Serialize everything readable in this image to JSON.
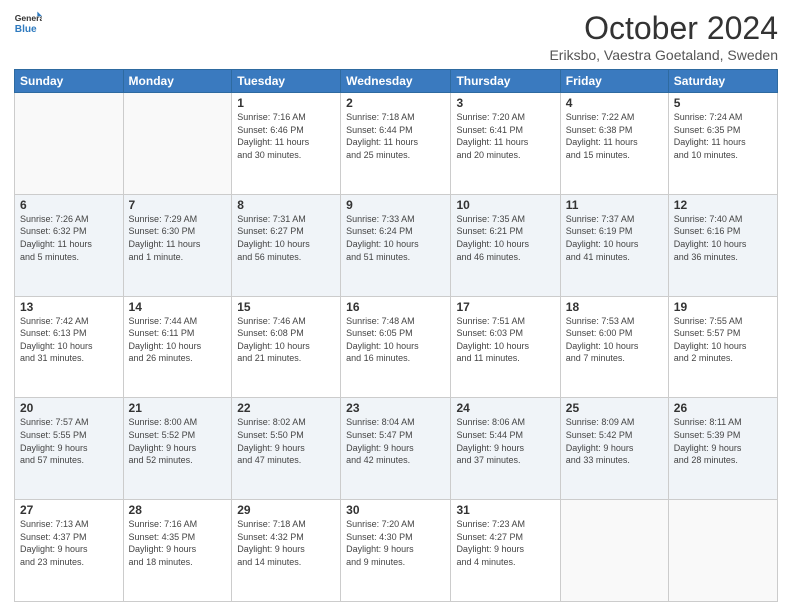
{
  "header": {
    "logo_line1": "General",
    "logo_line2": "Blue",
    "month": "October 2024",
    "location": "Eriksbo, Vaestra Goetaland, Sweden"
  },
  "days_of_week": [
    "Sunday",
    "Monday",
    "Tuesday",
    "Wednesday",
    "Thursday",
    "Friday",
    "Saturday"
  ],
  "weeks": [
    [
      {
        "day": "",
        "info": ""
      },
      {
        "day": "",
        "info": ""
      },
      {
        "day": "1",
        "info": "Sunrise: 7:16 AM\nSunset: 6:46 PM\nDaylight: 11 hours\nand 30 minutes."
      },
      {
        "day": "2",
        "info": "Sunrise: 7:18 AM\nSunset: 6:44 PM\nDaylight: 11 hours\nand 25 minutes."
      },
      {
        "day": "3",
        "info": "Sunrise: 7:20 AM\nSunset: 6:41 PM\nDaylight: 11 hours\nand 20 minutes."
      },
      {
        "day": "4",
        "info": "Sunrise: 7:22 AM\nSunset: 6:38 PM\nDaylight: 11 hours\nand 15 minutes."
      },
      {
        "day": "5",
        "info": "Sunrise: 7:24 AM\nSunset: 6:35 PM\nDaylight: 11 hours\nand 10 minutes."
      }
    ],
    [
      {
        "day": "6",
        "info": "Sunrise: 7:26 AM\nSunset: 6:32 PM\nDaylight: 11 hours\nand 5 minutes."
      },
      {
        "day": "7",
        "info": "Sunrise: 7:29 AM\nSunset: 6:30 PM\nDaylight: 11 hours\nand 1 minute."
      },
      {
        "day": "8",
        "info": "Sunrise: 7:31 AM\nSunset: 6:27 PM\nDaylight: 10 hours\nand 56 minutes."
      },
      {
        "day": "9",
        "info": "Sunrise: 7:33 AM\nSunset: 6:24 PM\nDaylight: 10 hours\nand 51 minutes."
      },
      {
        "day": "10",
        "info": "Sunrise: 7:35 AM\nSunset: 6:21 PM\nDaylight: 10 hours\nand 46 minutes."
      },
      {
        "day": "11",
        "info": "Sunrise: 7:37 AM\nSunset: 6:19 PM\nDaylight: 10 hours\nand 41 minutes."
      },
      {
        "day": "12",
        "info": "Sunrise: 7:40 AM\nSunset: 6:16 PM\nDaylight: 10 hours\nand 36 minutes."
      }
    ],
    [
      {
        "day": "13",
        "info": "Sunrise: 7:42 AM\nSunset: 6:13 PM\nDaylight: 10 hours\nand 31 minutes."
      },
      {
        "day": "14",
        "info": "Sunrise: 7:44 AM\nSunset: 6:11 PM\nDaylight: 10 hours\nand 26 minutes."
      },
      {
        "day": "15",
        "info": "Sunrise: 7:46 AM\nSunset: 6:08 PM\nDaylight: 10 hours\nand 21 minutes."
      },
      {
        "day": "16",
        "info": "Sunrise: 7:48 AM\nSunset: 6:05 PM\nDaylight: 10 hours\nand 16 minutes."
      },
      {
        "day": "17",
        "info": "Sunrise: 7:51 AM\nSunset: 6:03 PM\nDaylight: 10 hours\nand 11 minutes."
      },
      {
        "day": "18",
        "info": "Sunrise: 7:53 AM\nSunset: 6:00 PM\nDaylight: 10 hours\nand 7 minutes."
      },
      {
        "day": "19",
        "info": "Sunrise: 7:55 AM\nSunset: 5:57 PM\nDaylight: 10 hours\nand 2 minutes."
      }
    ],
    [
      {
        "day": "20",
        "info": "Sunrise: 7:57 AM\nSunset: 5:55 PM\nDaylight: 9 hours\nand 57 minutes."
      },
      {
        "day": "21",
        "info": "Sunrise: 8:00 AM\nSunset: 5:52 PM\nDaylight: 9 hours\nand 52 minutes."
      },
      {
        "day": "22",
        "info": "Sunrise: 8:02 AM\nSunset: 5:50 PM\nDaylight: 9 hours\nand 47 minutes."
      },
      {
        "day": "23",
        "info": "Sunrise: 8:04 AM\nSunset: 5:47 PM\nDaylight: 9 hours\nand 42 minutes."
      },
      {
        "day": "24",
        "info": "Sunrise: 8:06 AM\nSunset: 5:44 PM\nDaylight: 9 hours\nand 37 minutes."
      },
      {
        "day": "25",
        "info": "Sunrise: 8:09 AM\nSunset: 5:42 PM\nDaylight: 9 hours\nand 33 minutes."
      },
      {
        "day": "26",
        "info": "Sunrise: 8:11 AM\nSunset: 5:39 PM\nDaylight: 9 hours\nand 28 minutes."
      }
    ],
    [
      {
        "day": "27",
        "info": "Sunrise: 7:13 AM\nSunset: 4:37 PM\nDaylight: 9 hours\nand 23 minutes."
      },
      {
        "day": "28",
        "info": "Sunrise: 7:16 AM\nSunset: 4:35 PM\nDaylight: 9 hours\nand 18 minutes."
      },
      {
        "day": "29",
        "info": "Sunrise: 7:18 AM\nSunset: 4:32 PM\nDaylight: 9 hours\nand 14 minutes."
      },
      {
        "day": "30",
        "info": "Sunrise: 7:20 AM\nSunset: 4:30 PM\nDaylight: 9 hours\nand 9 minutes."
      },
      {
        "day": "31",
        "info": "Sunrise: 7:23 AM\nSunset: 4:27 PM\nDaylight: 9 hours\nand 4 minutes."
      },
      {
        "day": "",
        "info": ""
      },
      {
        "day": "",
        "info": ""
      }
    ]
  ]
}
